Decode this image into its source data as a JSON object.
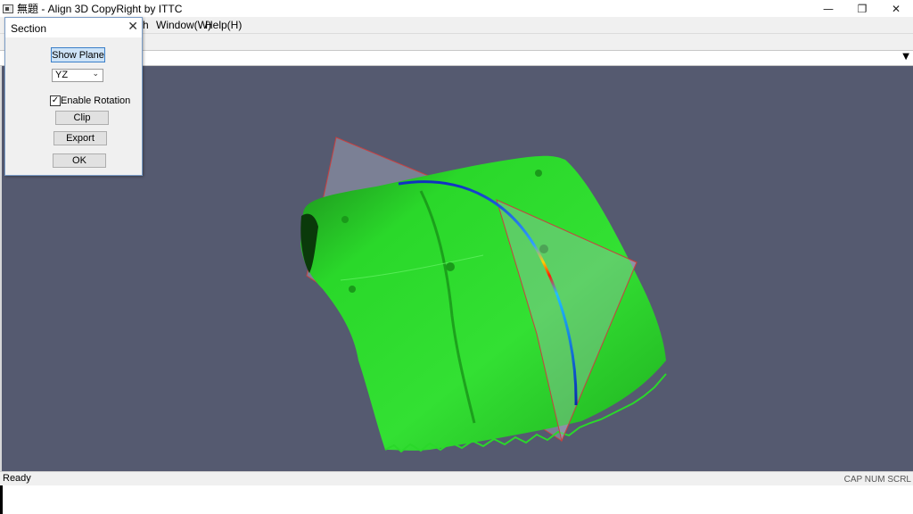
{
  "window": {
    "title": "無題 - Align 3D CopyRight by ITTC",
    "minimize_glyph": "—",
    "restore_glyph": "❐",
    "close_glyph": "✕"
  },
  "menu": {
    "items": [
      "h",
      "Window(W)",
      "Help(H)"
    ]
  },
  "combo_strip": {
    "arrow_glyph": "▼"
  },
  "dialog": {
    "title": "Section",
    "close_glyph": "✕",
    "show_plane_label": "Show Plane",
    "plane_select": {
      "value": "YZ",
      "arrow_glyph": "⌄"
    },
    "enable_rotation": {
      "label": "Enable Rotation",
      "checked": true,
      "check_glyph": "✓"
    },
    "clip_label": "Clip",
    "export_label": "Export",
    "ok_label": "OK"
  },
  "viewport": {
    "background": "#555a70",
    "mesh_color": "#22dd22",
    "plane_color": "#9aa0b4",
    "plane_border_color": "#c84040",
    "section_curve_colors": [
      "#1030c0",
      "#ffd000",
      "#ff2000"
    ]
  },
  "status": {
    "text": "Ready",
    "indicators": "CAP NUM SCRL"
  }
}
